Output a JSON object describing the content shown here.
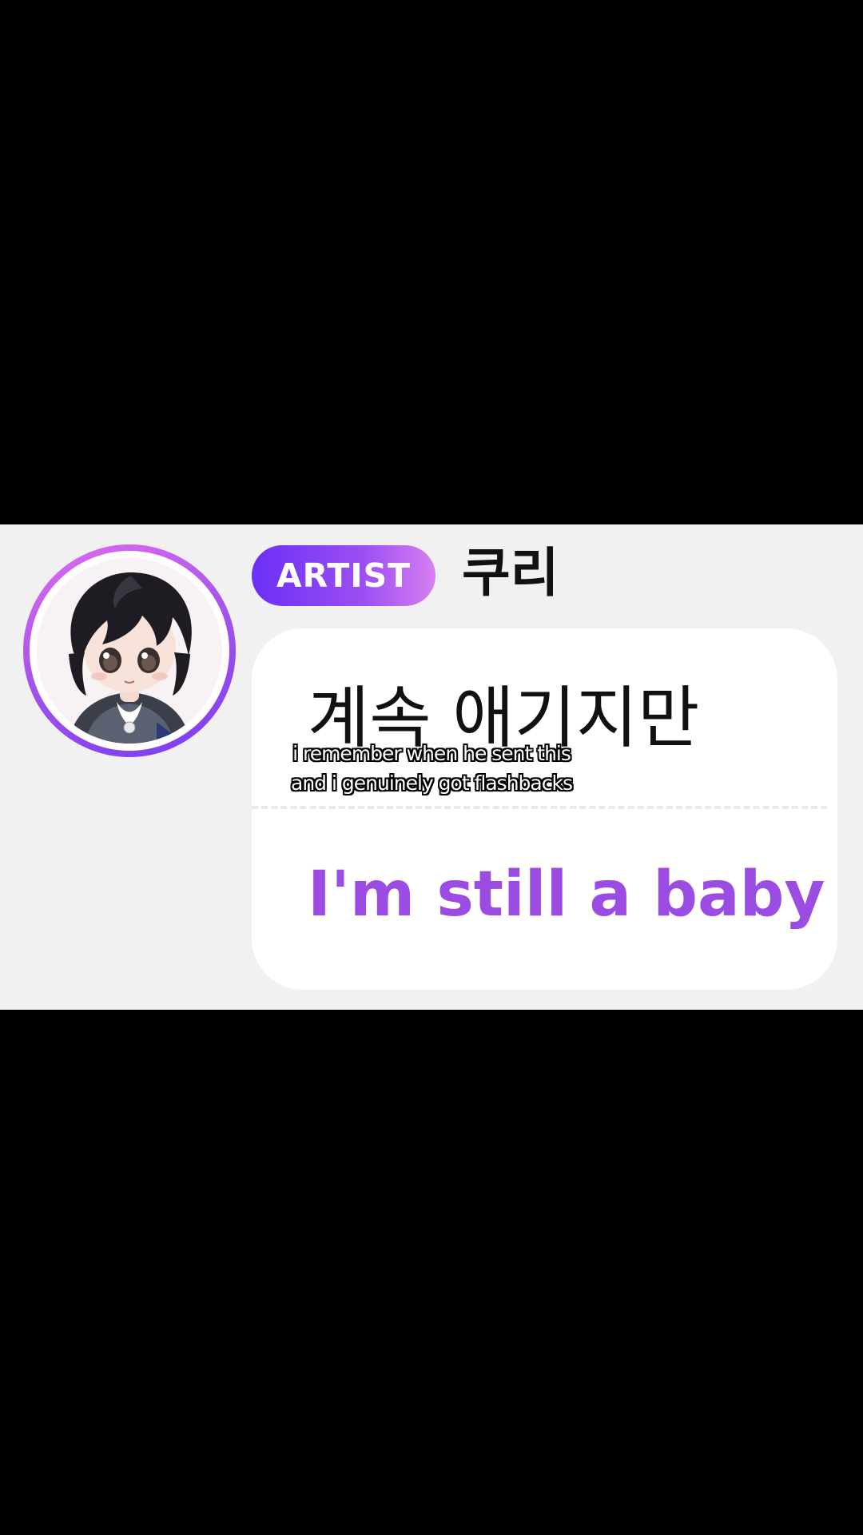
{
  "message": {
    "badge_label": "ARTIST",
    "artist_name": "쿠리",
    "original_text": "계속 애기지만",
    "translation_text": "I'm still a baby"
  },
  "caption": {
    "line1": "i remember when he sent this",
    "line2": "and i genuinely got flashbacks"
  },
  "colors": {
    "band_background": "#f1f1f1",
    "badge_gradient_start": "#6b2ff6",
    "badge_gradient_end": "#d77ff2",
    "translation_color": "#9a4ce3",
    "avatar_ring_start": "#e16cf0",
    "avatar_ring_end": "#7a3cf2"
  }
}
